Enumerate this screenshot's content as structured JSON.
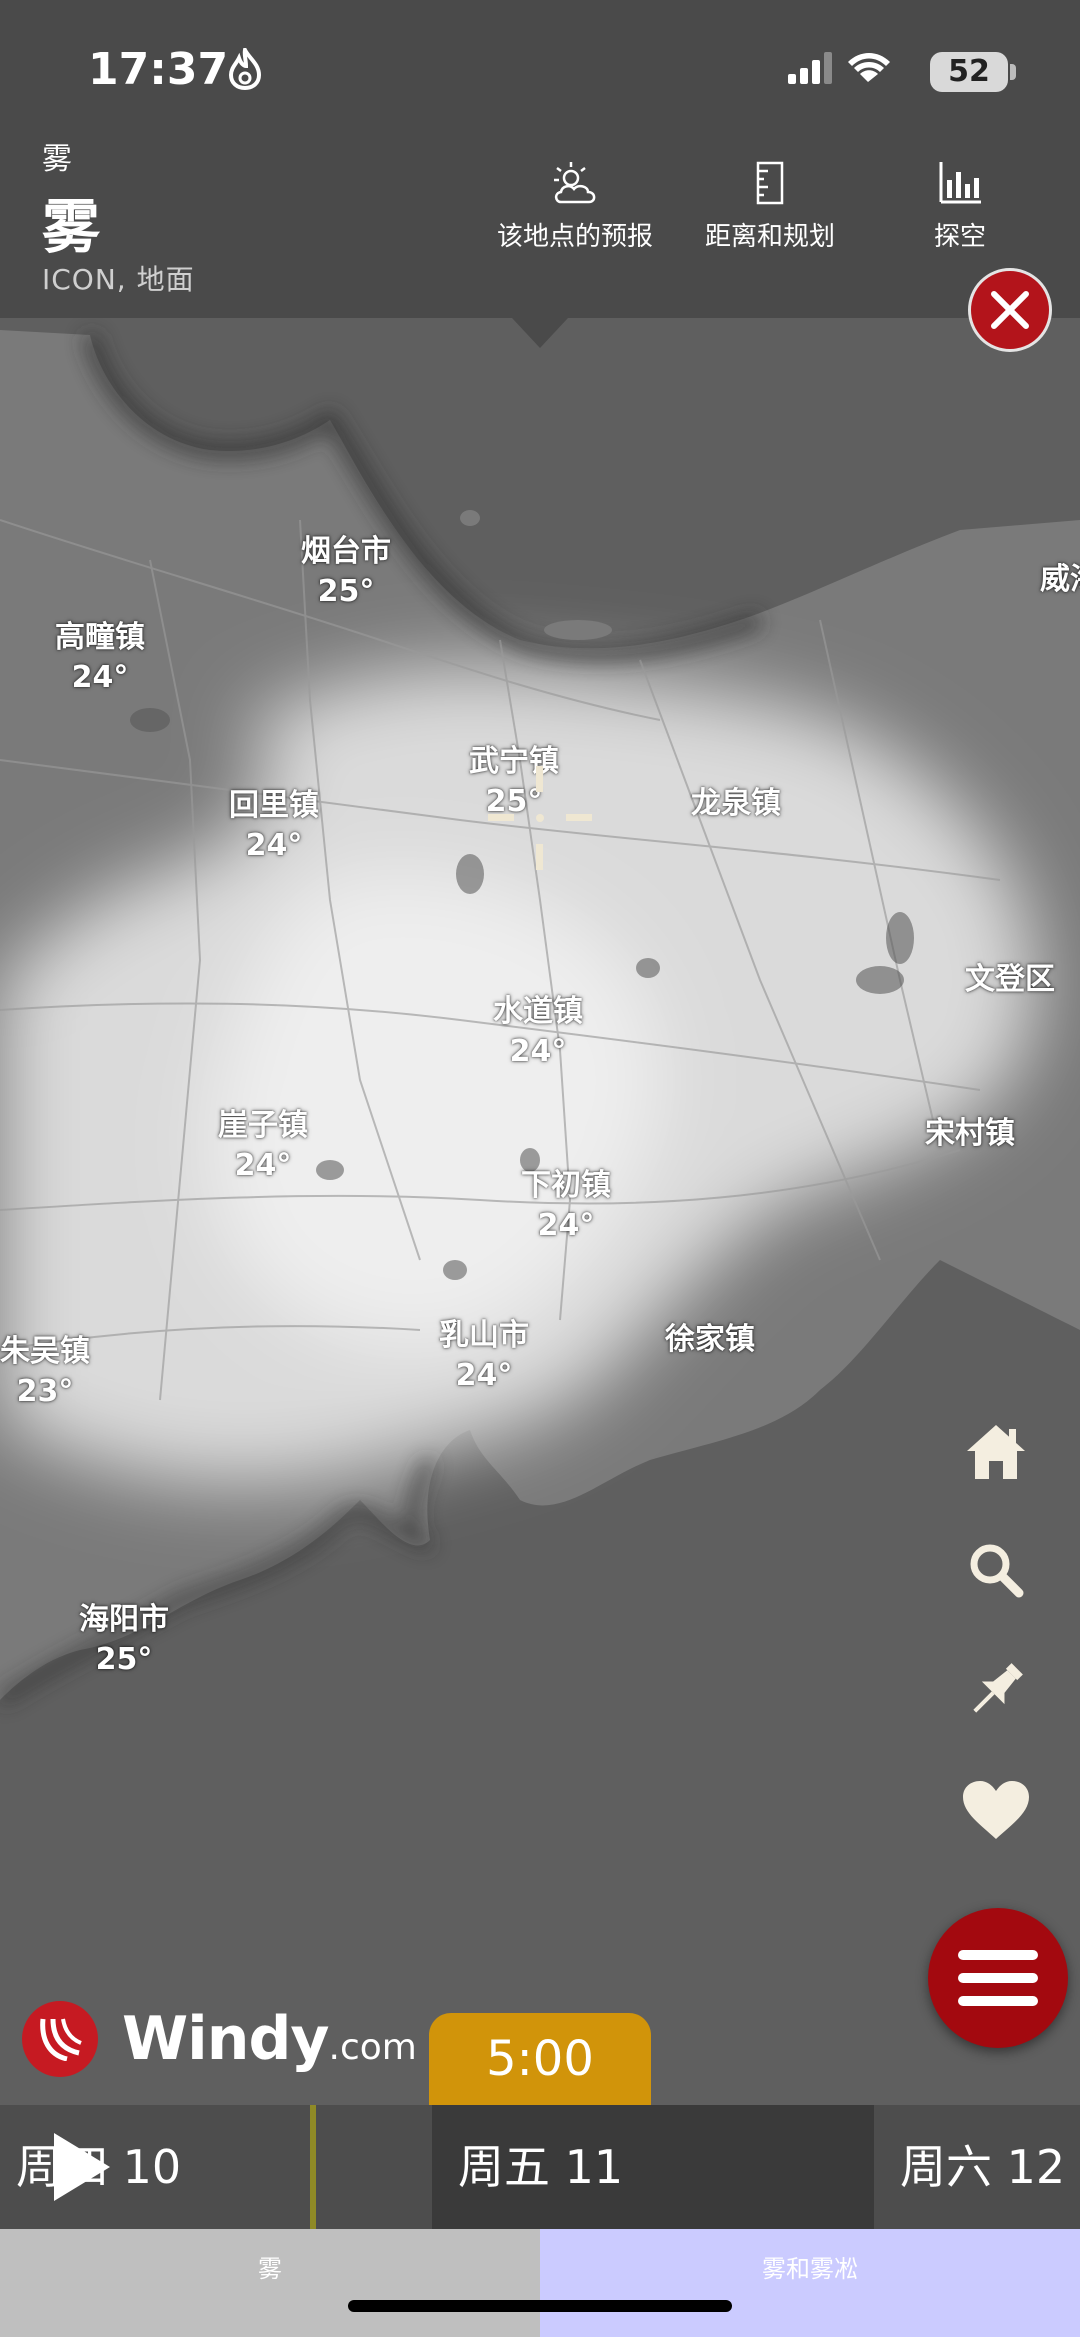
{
  "status_bar": {
    "time": "17:37",
    "battery": "52"
  },
  "header": {
    "layer_small": "雾",
    "layer_title": "雾",
    "model_info": "ICON, 地面",
    "buttons": [
      {
        "label": "该地点的预报",
        "icon": "weather-partly-cloudy-icon"
      },
      {
        "label": "距离和规划",
        "icon": "ruler-icon"
      },
      {
        "label": "探空",
        "icon": "bar-chart-icon"
      }
    ]
  },
  "map": {
    "places": [
      {
        "name": "烟台市",
        "temp": "25°"
      },
      {
        "name": "威海",
        "temp": ""
      },
      {
        "name": "高疃镇",
        "temp": "24°"
      },
      {
        "name": "武宁镇",
        "temp": "25°"
      },
      {
        "name": "龙泉镇",
        "temp": ""
      },
      {
        "name": "回里镇",
        "temp": "24°"
      },
      {
        "name": "文登区",
        "temp": ""
      },
      {
        "name": "水道镇",
        "temp": "24°"
      },
      {
        "name": "崖子镇",
        "temp": "24°"
      },
      {
        "name": "宋村镇",
        "temp": ""
      },
      {
        "name": "下初镇",
        "temp": "24°"
      },
      {
        "name": "乳山市",
        "temp": "24°"
      },
      {
        "name": "徐家镇",
        "temp": ""
      },
      {
        "name": "朱吴镇",
        "temp": "23°"
      },
      {
        "name": "海阳市",
        "temp": "25°"
      }
    ]
  },
  "controls": [
    "home-icon",
    "search-icon",
    "pin-icon",
    "heart-icon",
    "menu-icon"
  ],
  "logo": {
    "name": "Windy",
    "suffix": ".com"
  },
  "timeline": {
    "current_time": "5:00",
    "days": [
      "周四 10",
      "周五 11",
      "周六 12"
    ]
  },
  "tabs": [
    "雾",
    "雾和雾凇"
  ],
  "colors": {
    "close": "#b3141b",
    "menu": "#a3090f",
    "time_bubble": "#d1940a",
    "tab_active": "#cbcbff"
  }
}
